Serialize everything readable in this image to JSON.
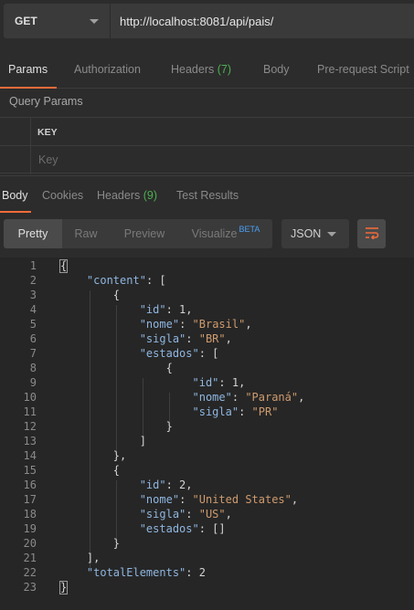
{
  "request": {
    "method": "GET",
    "url": "http://localhost:8081/api/pais/"
  },
  "request_tabs": [
    {
      "label": "Params",
      "count": ""
    },
    {
      "label": "Authorization",
      "count": ""
    },
    {
      "label": "Headers",
      "count": "(7)"
    },
    {
      "label": "Body",
      "count": ""
    },
    {
      "label": "Pre-request Script",
      "count": ""
    }
  ],
  "query_params": {
    "title": "Query Params",
    "key_header": "KEY",
    "key_placeholder": "Key"
  },
  "response_tabs": [
    {
      "label": "Body",
      "count": ""
    },
    {
      "label": "Cookies",
      "count": ""
    },
    {
      "label": "Headers",
      "count": "(9)"
    },
    {
      "label": "Test Results",
      "count": ""
    }
  ],
  "view_modes": {
    "pretty": "Pretty",
    "raw": "Raw",
    "preview": "Preview",
    "visualize": "Visualize",
    "visualize_badge": "BETA"
  },
  "format": "JSON",
  "code_lines": [
    {
      "ln": "1",
      "text": "{"
    },
    {
      "ln": "2",
      "text": "    \"content\": ["
    },
    {
      "ln": "3",
      "text": "        {"
    },
    {
      "ln": "4",
      "text": "            \"id\": 1,"
    },
    {
      "ln": "5",
      "text": "            \"nome\": \"Brasil\","
    },
    {
      "ln": "6",
      "text": "            \"sigla\": \"BR\","
    },
    {
      "ln": "7",
      "text": "            \"estados\": ["
    },
    {
      "ln": "8",
      "text": "                {"
    },
    {
      "ln": "9",
      "text": "                    \"id\": 1,"
    },
    {
      "ln": "10",
      "text": "                    \"nome\": \"Paraná\","
    },
    {
      "ln": "11",
      "text": "                    \"sigla\": \"PR\""
    },
    {
      "ln": "12",
      "text": "                }"
    },
    {
      "ln": "13",
      "text": "            ]"
    },
    {
      "ln": "14",
      "text": "        },"
    },
    {
      "ln": "15",
      "text": "        {"
    },
    {
      "ln": "16",
      "text": "            \"id\": 2,"
    },
    {
      "ln": "17",
      "text": "            \"nome\": \"United States\","
    },
    {
      "ln": "18",
      "text": "            \"sigla\": \"US\","
    },
    {
      "ln": "19",
      "text": "            \"estados\": []"
    },
    {
      "ln": "20",
      "text": "        }"
    },
    {
      "ln": "21",
      "text": "    ],"
    },
    {
      "ln": "22",
      "text": "    \"totalElements\": 2"
    },
    {
      "ln": "23",
      "text": "}"
    }
  ],
  "colors": {
    "accent": "#f26b3a",
    "count": "#4caf50",
    "json_key": "#8fb6e0",
    "json_string": "#ce9b6e",
    "beta": "#4a9ff5"
  }
}
